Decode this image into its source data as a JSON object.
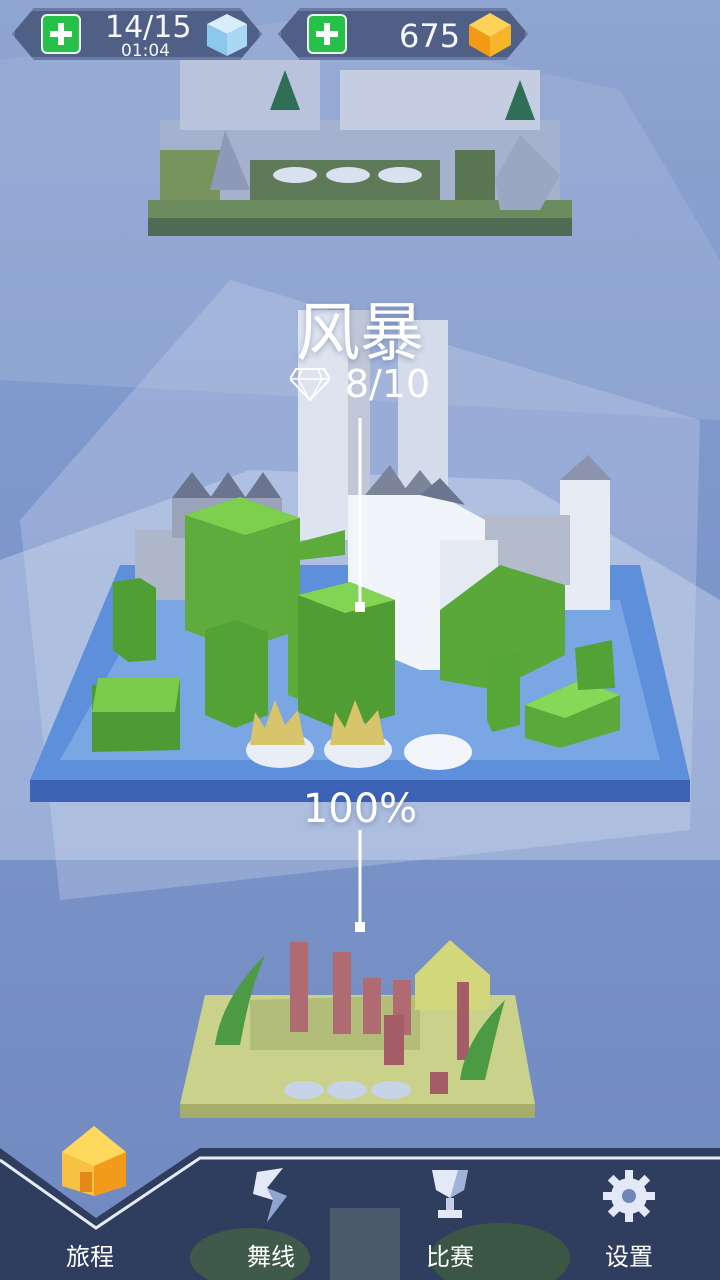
{
  "lives": {
    "count": "14/15",
    "timer": "01:04"
  },
  "gems": {
    "count": "675"
  },
  "level": {
    "name": "风暴",
    "diamonds": "8/10",
    "progress": "100%"
  },
  "nav": [
    {
      "label": "旅程",
      "icon": "house-icon"
    },
    {
      "label": "舞线",
      "icon": "line-icon"
    },
    {
      "label": "比赛",
      "icon": "trophy-icon"
    },
    {
      "label": "设置",
      "icon": "gear-icon"
    }
  ],
  "colors": {
    "grass": "#6fbf45",
    "pill": "#4f5f86",
    "plus": "#27c14a",
    "gem": "#f4a41e",
    "navbar": "#2f3e5e"
  }
}
